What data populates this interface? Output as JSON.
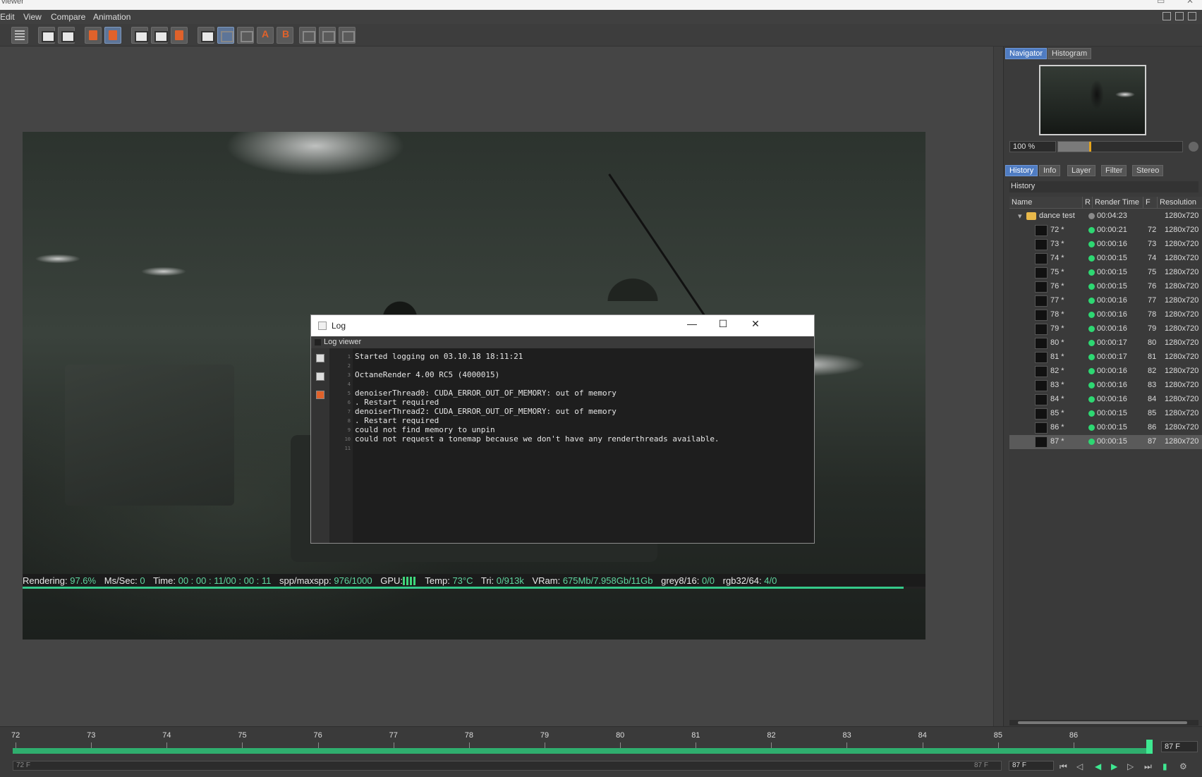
{
  "app": {
    "title": "viewer"
  },
  "menu": [
    "Edit",
    "View",
    "Compare",
    "Animation"
  ],
  "log": {
    "title": "Log",
    "subtitle": "Log viewer",
    "controls": {
      "minimize": "—",
      "maximize": "☐",
      "close": "✕"
    },
    "lines": [
      "Started logging on 03.10.18 18:11:21",
      "",
      "OctaneRender 4.00 RC5 (4000015)",
      "",
      "denoiserThread0: CUDA_ERROR_OUT_OF_MEMORY: out of memory",
      ". Restart required",
      "denoiserThread2: CUDA_ERROR_OUT_OF_MEMORY: out of memory",
      ". Restart required",
      "could not find memory to unpin",
      "could not request a tonemap because we don't have any renderthreads available.",
      ""
    ]
  },
  "status": {
    "rendering_label": "Rendering:",
    "rendering": "97.6%",
    "mssec_label": "Ms/Sec:",
    "mssec": "0",
    "time_label": "Time:",
    "time": "00 : 00 : 11/00 : 00 : 11",
    "spp_label": "spp/maxspp:",
    "spp": "976/1000",
    "gpu_label": "GPU:",
    "temp_label": "Temp:",
    "temp": "73°C",
    "tri_label": "Tri:",
    "tri": "0/913k",
    "vram_label": "VRam:",
    "vram": "675Mb/7.958Gb/11Gb",
    "grey_label": "grey8/16:",
    "grey": "0/0",
    "rgb_label": "rgb32/64:",
    "rgb": "4/0",
    "progress_fraction": 0.976
  },
  "navigator": {
    "tabs": [
      "Navigator",
      "Histogram"
    ],
    "zoom": "100 %",
    "zoom_fraction": 0.25
  },
  "panel_tabs": [
    "History",
    "Info",
    "Layer",
    "Filter",
    "Stereo"
  ],
  "history": {
    "title": "History",
    "columns": [
      "Name",
      "R",
      "Render Time",
      "F",
      "Resolution"
    ],
    "group": {
      "name": "dance test",
      "time": "00:04:23",
      "res": "1280x720"
    },
    "rows": [
      {
        "name": "72 *",
        "time": "00:00:21",
        "frame": "72",
        "res": "1280x720"
      },
      {
        "name": "73 *",
        "time": "00:00:16",
        "frame": "73",
        "res": "1280x720"
      },
      {
        "name": "74 *",
        "time": "00:00:15",
        "frame": "74",
        "res": "1280x720"
      },
      {
        "name": "75 *",
        "time": "00:00:15",
        "frame": "75",
        "res": "1280x720"
      },
      {
        "name": "76 *",
        "time": "00:00:15",
        "frame": "76",
        "res": "1280x720"
      },
      {
        "name": "77 *",
        "time": "00:00:16",
        "frame": "77",
        "res": "1280x720"
      },
      {
        "name": "78 *",
        "time": "00:00:16",
        "frame": "78",
        "res": "1280x720"
      },
      {
        "name": "79 *",
        "time": "00:00:16",
        "frame": "79",
        "res": "1280x720"
      },
      {
        "name": "80 *",
        "time": "00:00:17",
        "frame": "80",
        "res": "1280x720"
      },
      {
        "name": "81 *",
        "time": "00:00:17",
        "frame": "81",
        "res": "1280x720"
      },
      {
        "name": "82 *",
        "time": "00:00:16",
        "frame": "82",
        "res": "1280x720"
      },
      {
        "name": "83 *",
        "time": "00:00:16",
        "frame": "83",
        "res": "1280x720"
      },
      {
        "name": "84 *",
        "time": "00:00:16",
        "frame": "84",
        "res": "1280x720"
      },
      {
        "name": "85 *",
        "time": "00:00:15",
        "frame": "85",
        "res": "1280x720"
      },
      {
        "name": "86 *",
        "time": "00:00:15",
        "frame": "86",
        "res": "1280x720"
      },
      {
        "name": "87 *",
        "time": "00:00:15",
        "frame": "87",
        "res": "1280x720"
      }
    ]
  },
  "timeline": {
    "ticks": [
      "72",
      "73",
      "74",
      "75",
      "76",
      "77",
      "78",
      "79",
      "80",
      "81",
      "82",
      "83",
      "84",
      "85",
      "86"
    ],
    "current_frame": "87 F",
    "start_frame": "72 F",
    "end_frame": "87 F",
    "end_field": "87 F"
  },
  "colors": {
    "accent": "#4f7cc2",
    "status_green": "#5fd7a0",
    "progress": "#35c98a",
    "timeline_green": "#2fae6e"
  }
}
